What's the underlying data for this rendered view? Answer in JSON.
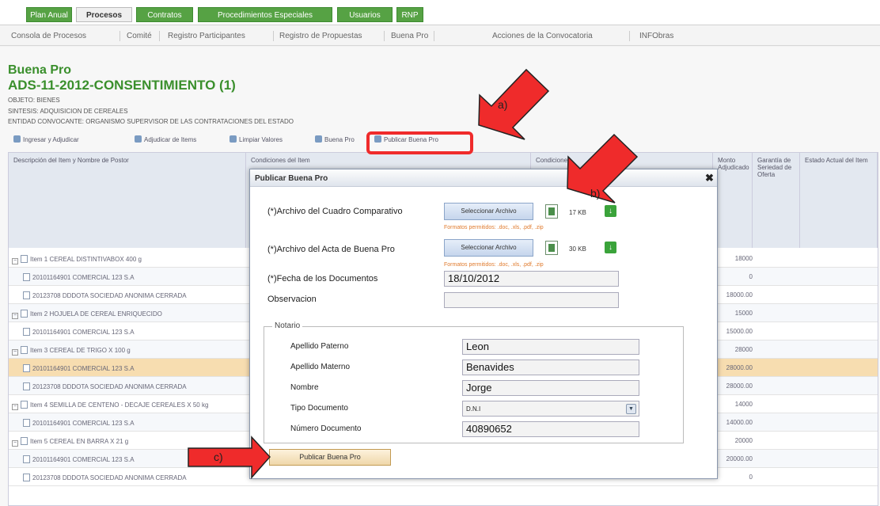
{
  "top_tabs": [
    {
      "label": "Plan Anual",
      "active": false
    },
    {
      "label": "Procesos",
      "active": true
    },
    {
      "label": "Contratos",
      "active": false
    },
    {
      "label": "Procedimientos Especiales",
      "active": false
    },
    {
      "label": "Usuarios",
      "active": false
    },
    {
      "label": "RNP",
      "active": false
    }
  ],
  "sub_nav": [
    "Consola de Procesos",
    "Comité",
    "Registro Participantes",
    "Registro de Propuestas",
    "Buena Pro",
    "Acciones de la Convocatoria",
    "INFObras"
  ],
  "page": {
    "title": "Buena Pro",
    "subtitle": "ADS-11-2012-CONSENTIMIENTO (1)",
    "objeto": "OBJETO: BIENES",
    "sintesis": "SINTESIS: ADQUISICION DE CEREALES",
    "entidad": "ENTIDAD CONVOCANTE: ORGANISMO SUPERVISOR DE LAS CONTRATACIONES DEL ESTADO"
  },
  "toolbar": {
    "items": [
      "Ingresar y Adjudicar",
      "Adjudicar de Items",
      "Limpiar Valores",
      "Buena Pro",
      "Publicar Buena Pro"
    ]
  },
  "grid": {
    "headers": [
      "Descripción del Item y Nombre de Postor",
      "Condiciones del Item",
      "Condiciones",
      "Monto Adjudicado",
      "Garantía de Seriedad de Oferta",
      "Estado Actual del Item"
    ],
    "rows": [
      {
        "text": "Item 1 CEREAL DISTINTIVABOX 400 g",
        "value": "18000",
        "type": "item"
      },
      {
        "text": "20101164901 COMERCIAL 123 S.A",
        "value": "0",
        "type": "bidder"
      },
      {
        "text": "20123708 DDDOTA SOCIEDAD ANONIMA CERRADA",
        "value": "18000.00",
        "type": "bidder"
      },
      {
        "text": "Item 2 HOJUELA DE CEREAL ENRIQUECIDO",
        "value": "15000",
        "type": "item"
      },
      {
        "text": "20101164901 COMERCIAL 123 S.A",
        "value": "15000.00",
        "type": "bidder"
      },
      {
        "text": "Item 3 CEREAL DE TRIGO X 100 g",
        "value": "28000",
        "type": "item"
      },
      {
        "text": "20101164901 COMERCIAL 123 S.A",
        "value": "28000.00",
        "type": "selected"
      },
      {
        "text": "20123708 DDDOTA SOCIEDAD ANONIMA CERRADA",
        "value": "28000.00",
        "type": "bidder"
      },
      {
        "text": "Item 4 SEMILLA DE CENTENO - DECAJE CEREALES X 50 kg",
        "value": "14000",
        "type": "item"
      },
      {
        "text": "20101164901 COMERCIAL 123 S.A",
        "value": "14000.00",
        "type": "bidder"
      },
      {
        "text": "Item 5 CEREAL EN BARRA X 21 g",
        "value": "20000",
        "type": "item"
      },
      {
        "text": "20101164901 COMERCIAL 123 S.A",
        "value": "20000.00",
        "type": "bidder"
      },
      {
        "text": "20123708 DDDOTA SOCIEDAD ANONIMA CERRADA",
        "value": "0",
        "type": "bidder"
      }
    ]
  },
  "modal": {
    "title": "Publicar Buena Pro",
    "close": "✖",
    "cuadro_label": "(*)Archivo del Cuadro Comparativo",
    "cuadro_button": "Seleccionar Archivo",
    "cuadro_size": "17 KB",
    "acta_label": "(*)Archivo del Acta de Buena Pro",
    "acta_button": "Seleccionar Archivo",
    "acta_size": "30 KB",
    "formats_hint": "Formatos permitidos: .doc, .xls, .pdf, .zip",
    "fecha_label": "(*)Fecha de los Documentos",
    "fecha_value": "18/10/2012",
    "obs_label": "Observacion",
    "obs_value": "",
    "notario_legend": "Notario",
    "apellido_paterno_label": "Apellido Paterno",
    "apellido_paterno_value": "Leon",
    "apellido_materno_label": "Apellido Materno",
    "apellido_materno_value": "Benavides",
    "nombre_label": "Nombre",
    "nombre_value": "Jorge",
    "tipo_doc_label": "Tipo Documento",
    "tipo_doc_value": "D.N.I",
    "numero_doc_label": "Número Documento",
    "numero_doc_value": "40890652",
    "publish_button": "Publicar Buena Pro"
  },
  "callouts": {
    "a": "a)",
    "b": "b)",
    "c": "c)"
  },
  "colors": {
    "accent_green": "#56a244",
    "callout_red": "#ef2b2b",
    "selected_row": "#f7ddb0"
  }
}
